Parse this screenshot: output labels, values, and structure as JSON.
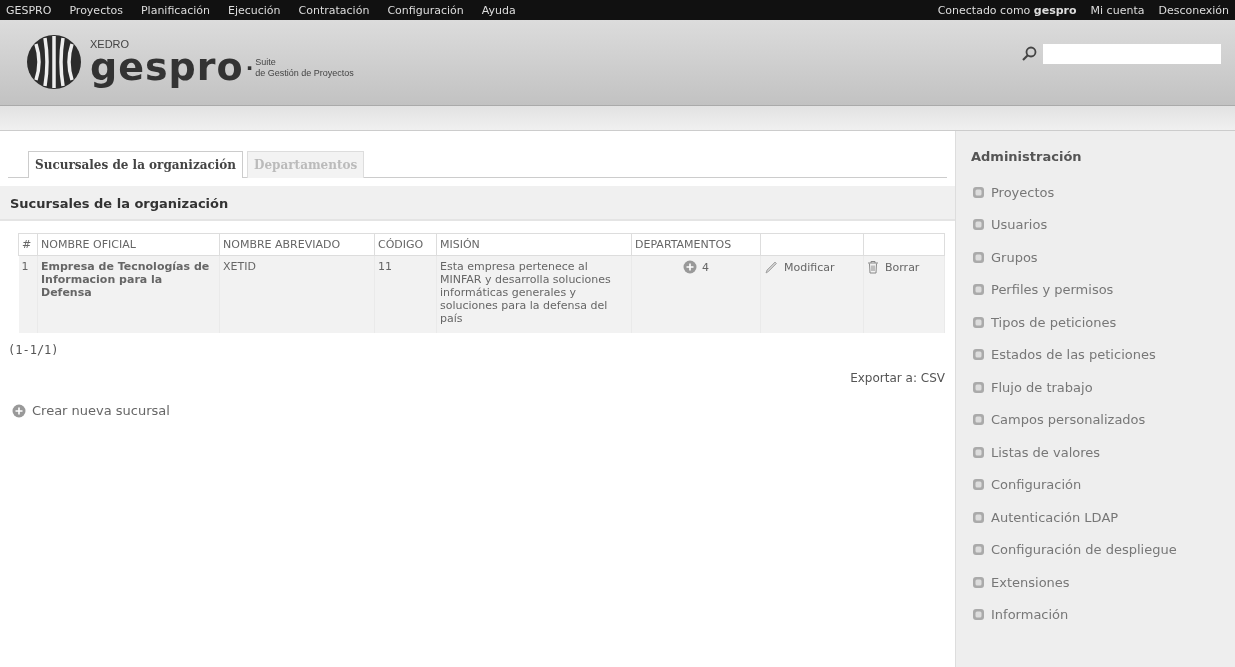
{
  "top_menu": {
    "brand": "GESPRO",
    "items": [
      "Proyectos",
      "Planificación",
      "Ejecución",
      "Contratación",
      "Configuración",
      "Ayuda"
    ],
    "logged_in": "Conectado como **gespro**",
    "account": "Mi cuenta",
    "logout": "Desconexión"
  },
  "header": {
    "logo_top": "XEDRO",
    "logo_name": "gespro",
    "logo_dot": "·",
    "logo_suite": "Suite",
    "logo_subtitle": "de Gestión de Proyectos"
  },
  "tabs": [
    {
      "label": "Sucursales de la organización",
      "selected": true
    },
    {
      "label": "Departamentos",
      "selected": false
    }
  ],
  "section_title": "Sucursales de la organización",
  "table": {
    "columns": [
      "#",
      "NOMBRE OFICIAL",
      "NOMBRE ABREVIADO",
      "CÓDIGO",
      "MISIÓN",
      "DEPARTAMENTOS"
    ],
    "rows": [
      {
        "number": "1",
        "name": "Empresa de Tecnologías de Informacion para la Defensa",
        "short_name": "XETID",
        "code": "11",
        "mission": "Esta empresa pertenece al MINFAR y desarrolla soluciones informáticas generales y soluciones para la defensa del país",
        "departments": "4",
        "edit": "Modificar",
        "delete": "Borrar"
      }
    ]
  },
  "pagination": "(1-1/1)",
  "export": "Exportar a: CSV",
  "create_link": "Crear nueva sucursal",
  "sidebar": {
    "title": "Administración",
    "items": [
      "Proyectos",
      "Usuarios",
      "Grupos",
      "Perfiles y permisos",
      "Tipos de peticiones",
      "Estados de las peticiones",
      "Flujo de trabajo",
      "Campos personalizados",
      "Listas de valores",
      "Configuración",
      "Autenticación LDAP",
      "Configuración de despliegue",
      "Extensiones",
      "Información"
    ]
  }
}
